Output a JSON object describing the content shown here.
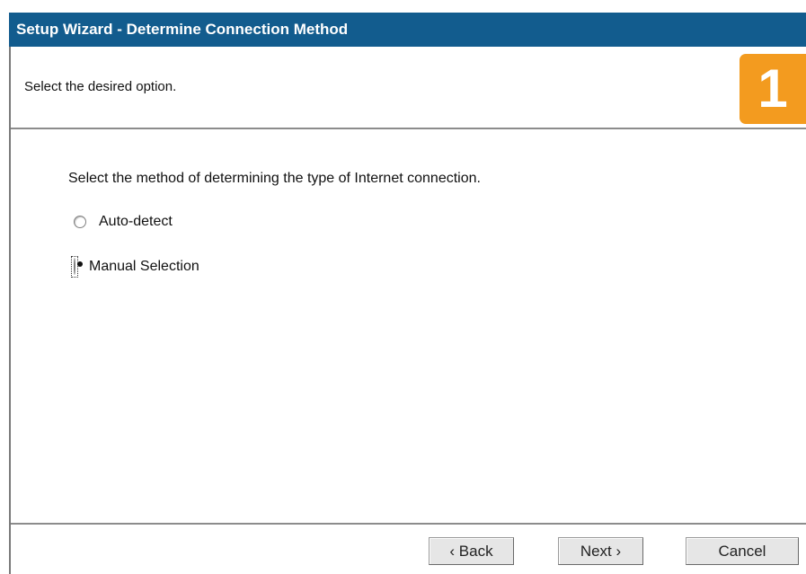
{
  "window": {
    "title": "Setup Wizard - Determine Connection Method"
  },
  "header": {
    "instruction": "Select the desired option.",
    "step_number": "1"
  },
  "main": {
    "prompt": "Select the method of determining the type of Internet connection.",
    "options": [
      {
        "label": "Auto-detect",
        "selected": false
      },
      {
        "label": "Manual Selection",
        "selected": true
      }
    ]
  },
  "footer": {
    "back_label": "‹ Back",
    "next_label": "Next ›",
    "cancel_label": "Cancel"
  },
  "colors": {
    "title_bar": "#125c8e",
    "step_badge": "#f39b1f"
  }
}
